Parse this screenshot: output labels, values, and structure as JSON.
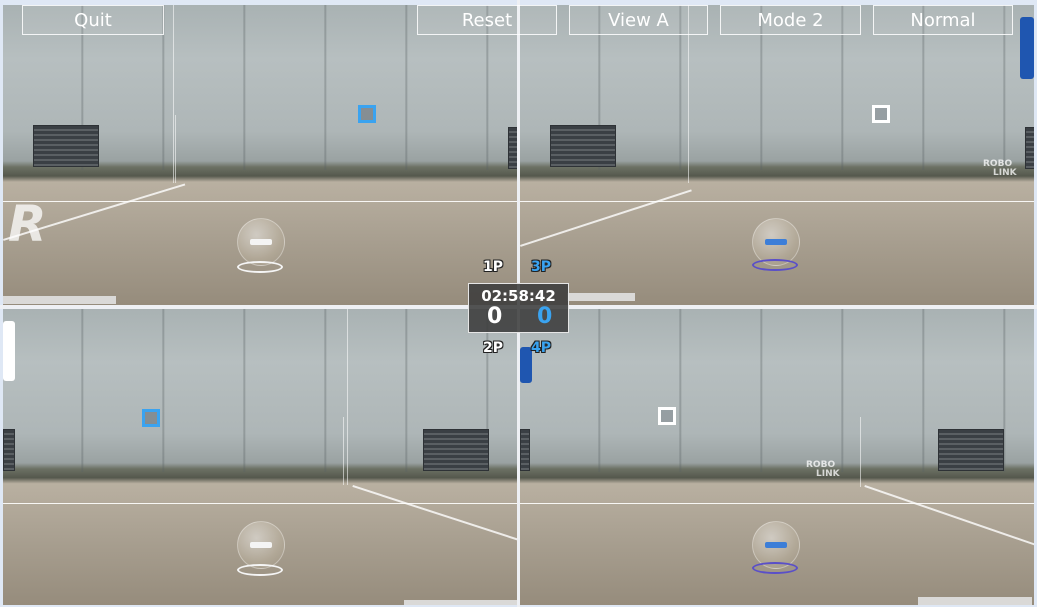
{
  "toolbar": {
    "quit_label": "Quit",
    "reset_label": "Reset",
    "view_label": "View A",
    "mode_label": "Mode 2",
    "difficulty_label": "Normal"
  },
  "hud": {
    "timer": "02:58:42",
    "score_left": "0",
    "score_right": "0",
    "score_left_color": "#ffffff",
    "score_right_color": "#3aa3f0"
  },
  "players": {
    "p1": {
      "tag": "1P",
      "color": "#ffffff"
    },
    "p2": {
      "tag": "2P",
      "color": "#ffffff"
    },
    "p3": {
      "tag": "3P",
      "color": "#3aa3f0"
    },
    "p4": {
      "tag": "4P",
      "color": "#3aa3f0"
    }
  },
  "scene": {
    "logo_letter": "R",
    "robolink_line1": "ROBO",
    "robolink_line2": "LINK",
    "icons": [
      "quadcopter-drone-icon",
      "square-gate-target-icon"
    ]
  }
}
